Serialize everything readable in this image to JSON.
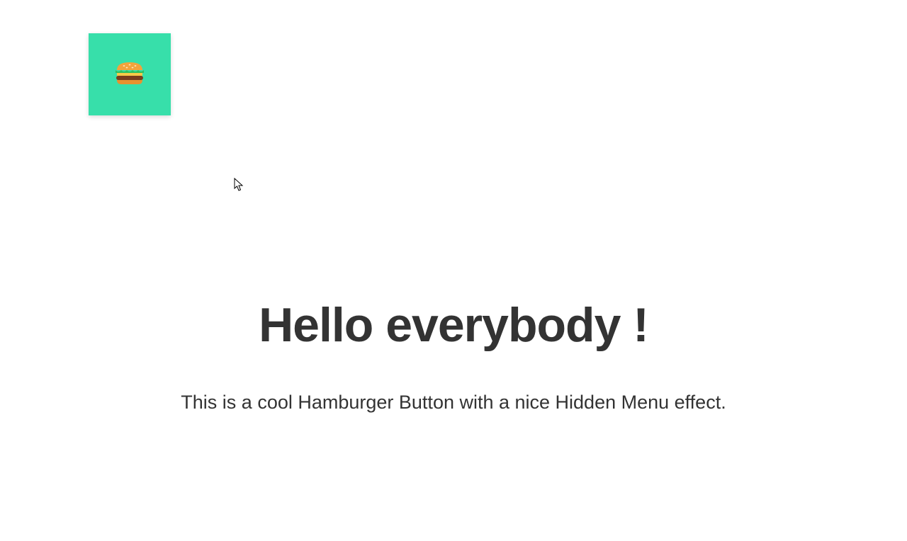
{
  "button": {
    "color": "#37dfaa",
    "icon_name": "hamburger-icon"
  },
  "content": {
    "heading": "Hello everybody !",
    "subheading": "This is a cool Hamburger Button with a nice Hidden Menu effect."
  }
}
